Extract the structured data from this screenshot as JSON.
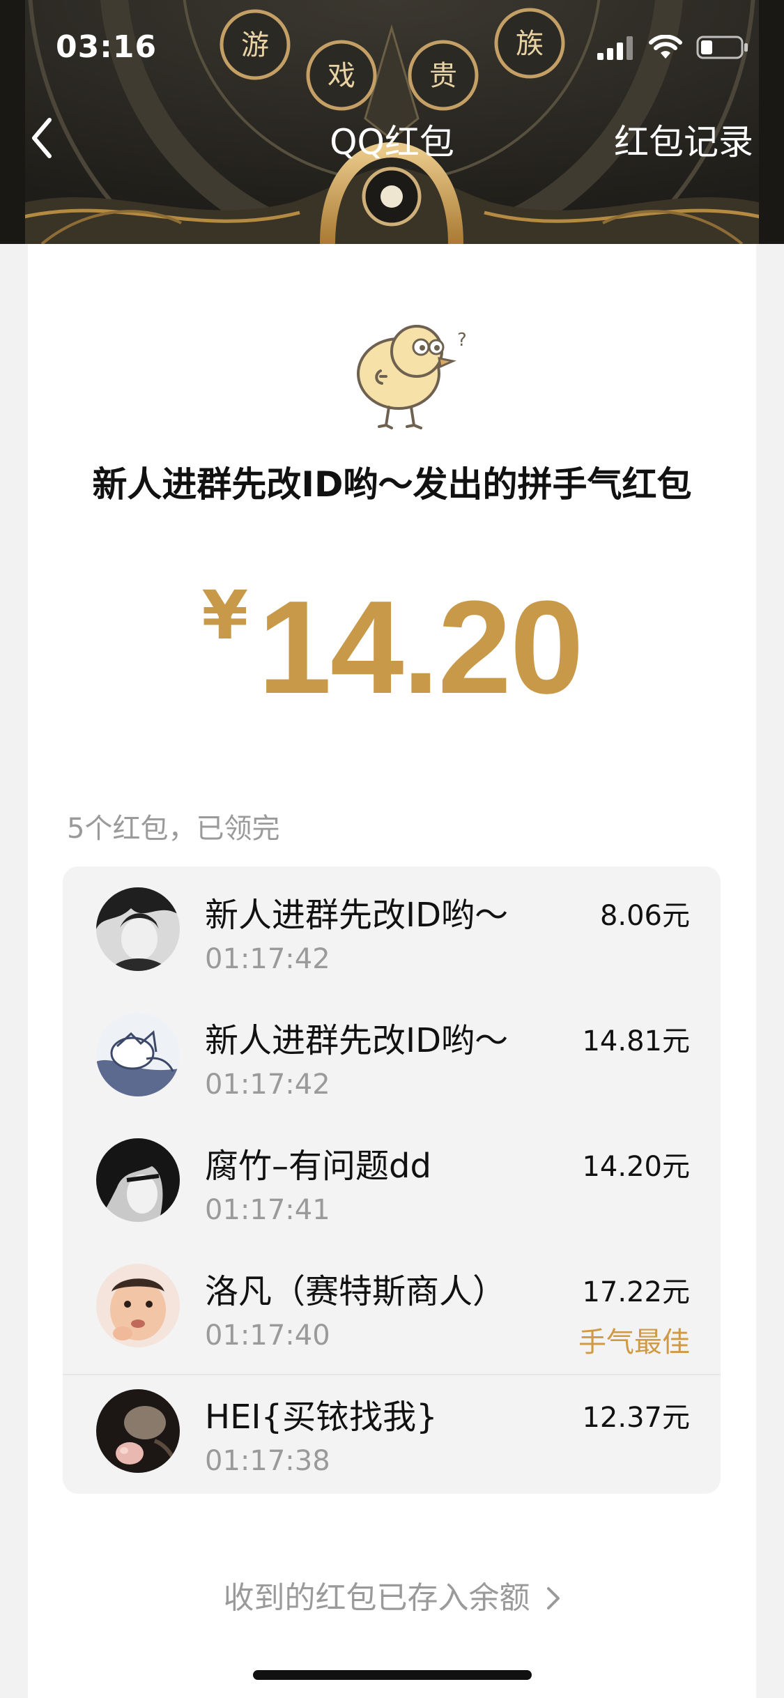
{
  "status_bar": {
    "time": "03:16"
  },
  "nav": {
    "back_icon": "chevron-left-icon",
    "title": "QQ红包",
    "history_label": "红包记录"
  },
  "header_decor": {
    "chars": [
      "游",
      "戏",
      "贵",
      "族"
    ]
  },
  "packet": {
    "sender_title": "新人进群先改ID哟～发出的拼手气红包",
    "currency_symbol": "¥",
    "amount": "14.20",
    "summary": "5个红包，已领完"
  },
  "recipients": [
    {
      "name": "新人进群先改ID哟～",
      "time": "01:17:42",
      "amount": "8.06元",
      "badge": ""
    },
    {
      "name": "新人进群先改ID哟～",
      "time": "01:17:42",
      "amount": "14.81元",
      "badge": ""
    },
    {
      "name": "腐竹–有问题dd",
      "time": "01:17:41",
      "amount": "14.20元",
      "badge": ""
    },
    {
      "name": "洛凡（赛特斯商人）",
      "time": "01:17:40",
      "amount": "17.22元",
      "badge": "手气最佳"
    },
    {
      "name": "HEI{买铱找我}",
      "time": "01:17:38",
      "amount": "12.37元",
      "badge": ""
    }
  ],
  "footer": {
    "link_label": "收到的红包已存入余额",
    "chevron_icon": "chevron-right-icon"
  },
  "colors": {
    "accent_gold": "#c9994a",
    "best_luck": "#d09a45",
    "header_bg": "#2a2823"
  }
}
